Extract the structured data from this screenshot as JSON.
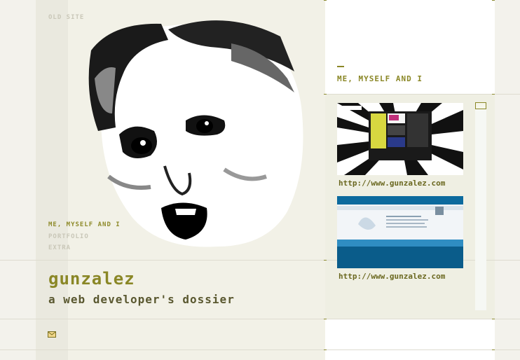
{
  "nav": {
    "old_site": "OLD SITE",
    "items": [
      "ME, MYSELF AND I",
      "PORTFOLIO",
      "EXTRA"
    ]
  },
  "site": {
    "title": "gunzalez",
    "subtitle": "a web developer's dossier"
  },
  "right_panel": {
    "heading": "ME, MYSELF AND I",
    "links": [
      "http://www.gunzalez.com",
      "http://www.gunzalez.com"
    ]
  },
  "icons": {
    "mail": "mail-icon"
  },
  "colors": {
    "accent": "#8a8726",
    "dark_accent": "#5a5830",
    "background": "#f3f2ec"
  }
}
